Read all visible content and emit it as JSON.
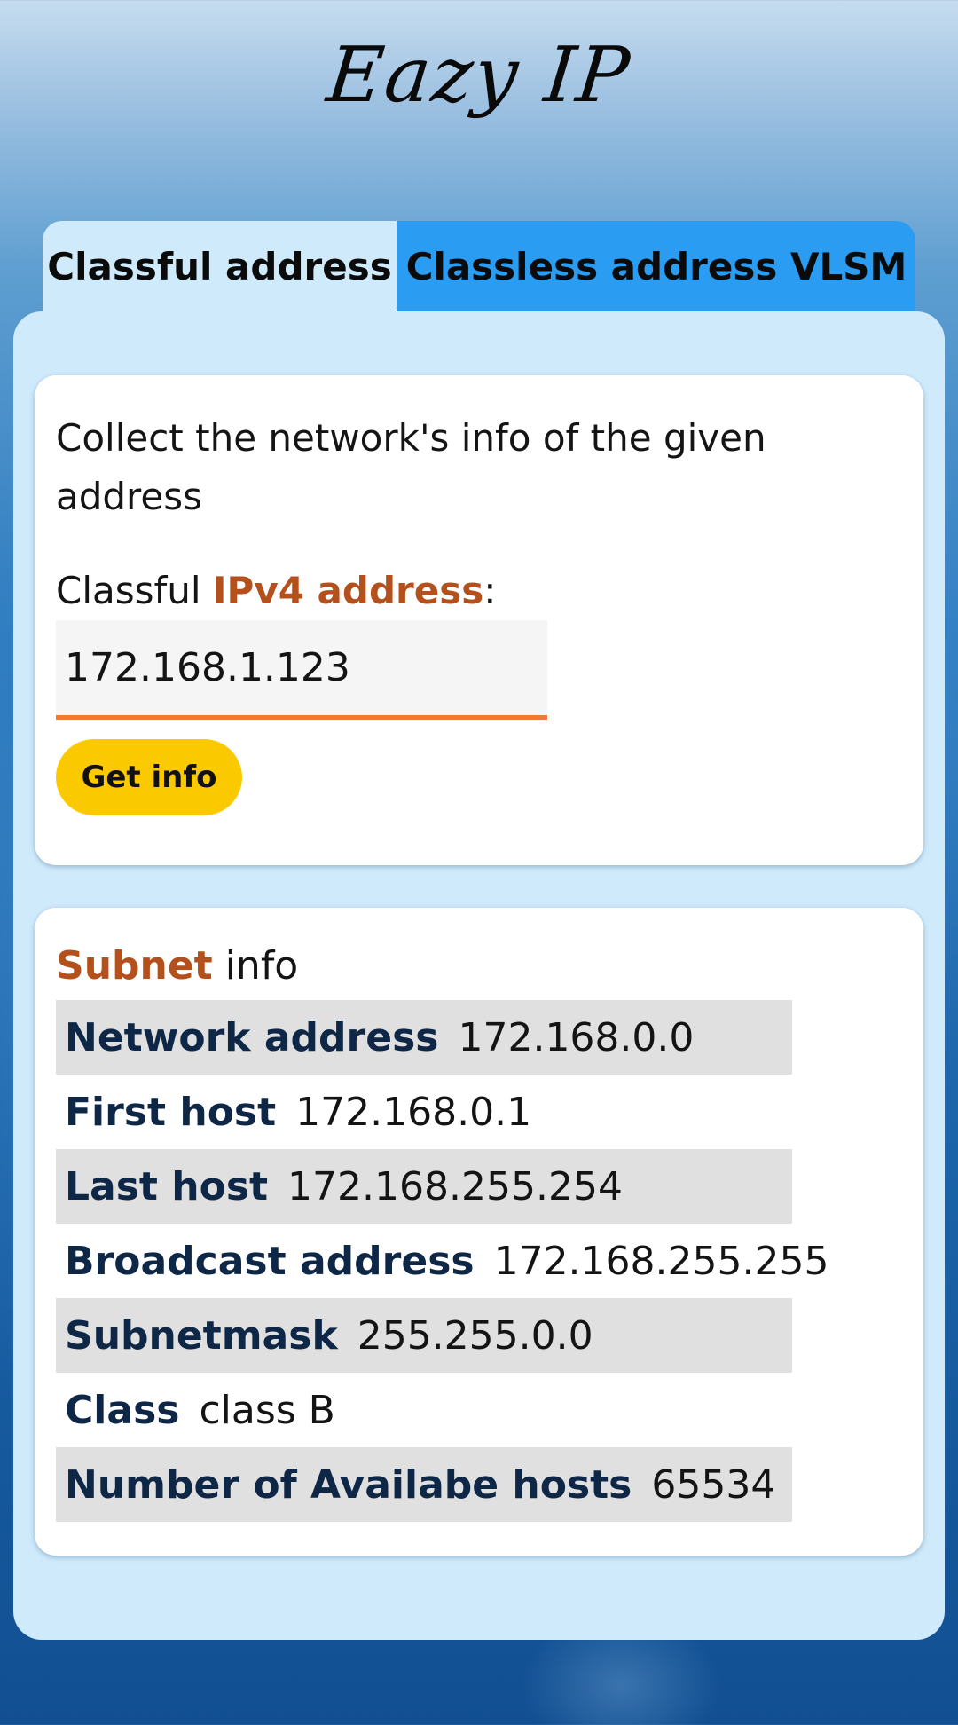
{
  "app": {
    "title": "Eazy IP"
  },
  "tabs": [
    {
      "label": "Classful address",
      "active": true
    },
    {
      "label": "Classless address",
      "active": false
    },
    {
      "label": "VLSM",
      "active": false
    }
  ],
  "form": {
    "intro": "Collect the network's info of the given address",
    "label_prefix": "Classful ",
    "label_highlight": "IPv4 address",
    "label_suffix": ":",
    "ip_value": "172.168.1.123",
    "button_label": "Get info"
  },
  "subnet": {
    "title_highlight": "Subnet",
    "title_rest": " info",
    "rows": [
      {
        "key": "Network address",
        "value": "172.168.0.0"
      },
      {
        "key": "First host",
        "value": "172.168.0.1"
      },
      {
        "key": "Last host",
        "value": "172.168.255.254"
      },
      {
        "key": "Broadcast address",
        "value": "172.168.255.255"
      },
      {
        "key": "Subnetmask",
        "value": "255.255.0.0"
      },
      {
        "key": "Class",
        "value": "class B"
      },
      {
        "key": "Number of Availabe hosts",
        "value": "65534"
      }
    ]
  },
  "colors": {
    "accent_orange": "#b3501c",
    "input_underline": "#ef7a38",
    "button_yellow": "#fbc900",
    "tab_blue": "#2a9cf2",
    "panel_light_blue": "#cfeafb"
  }
}
